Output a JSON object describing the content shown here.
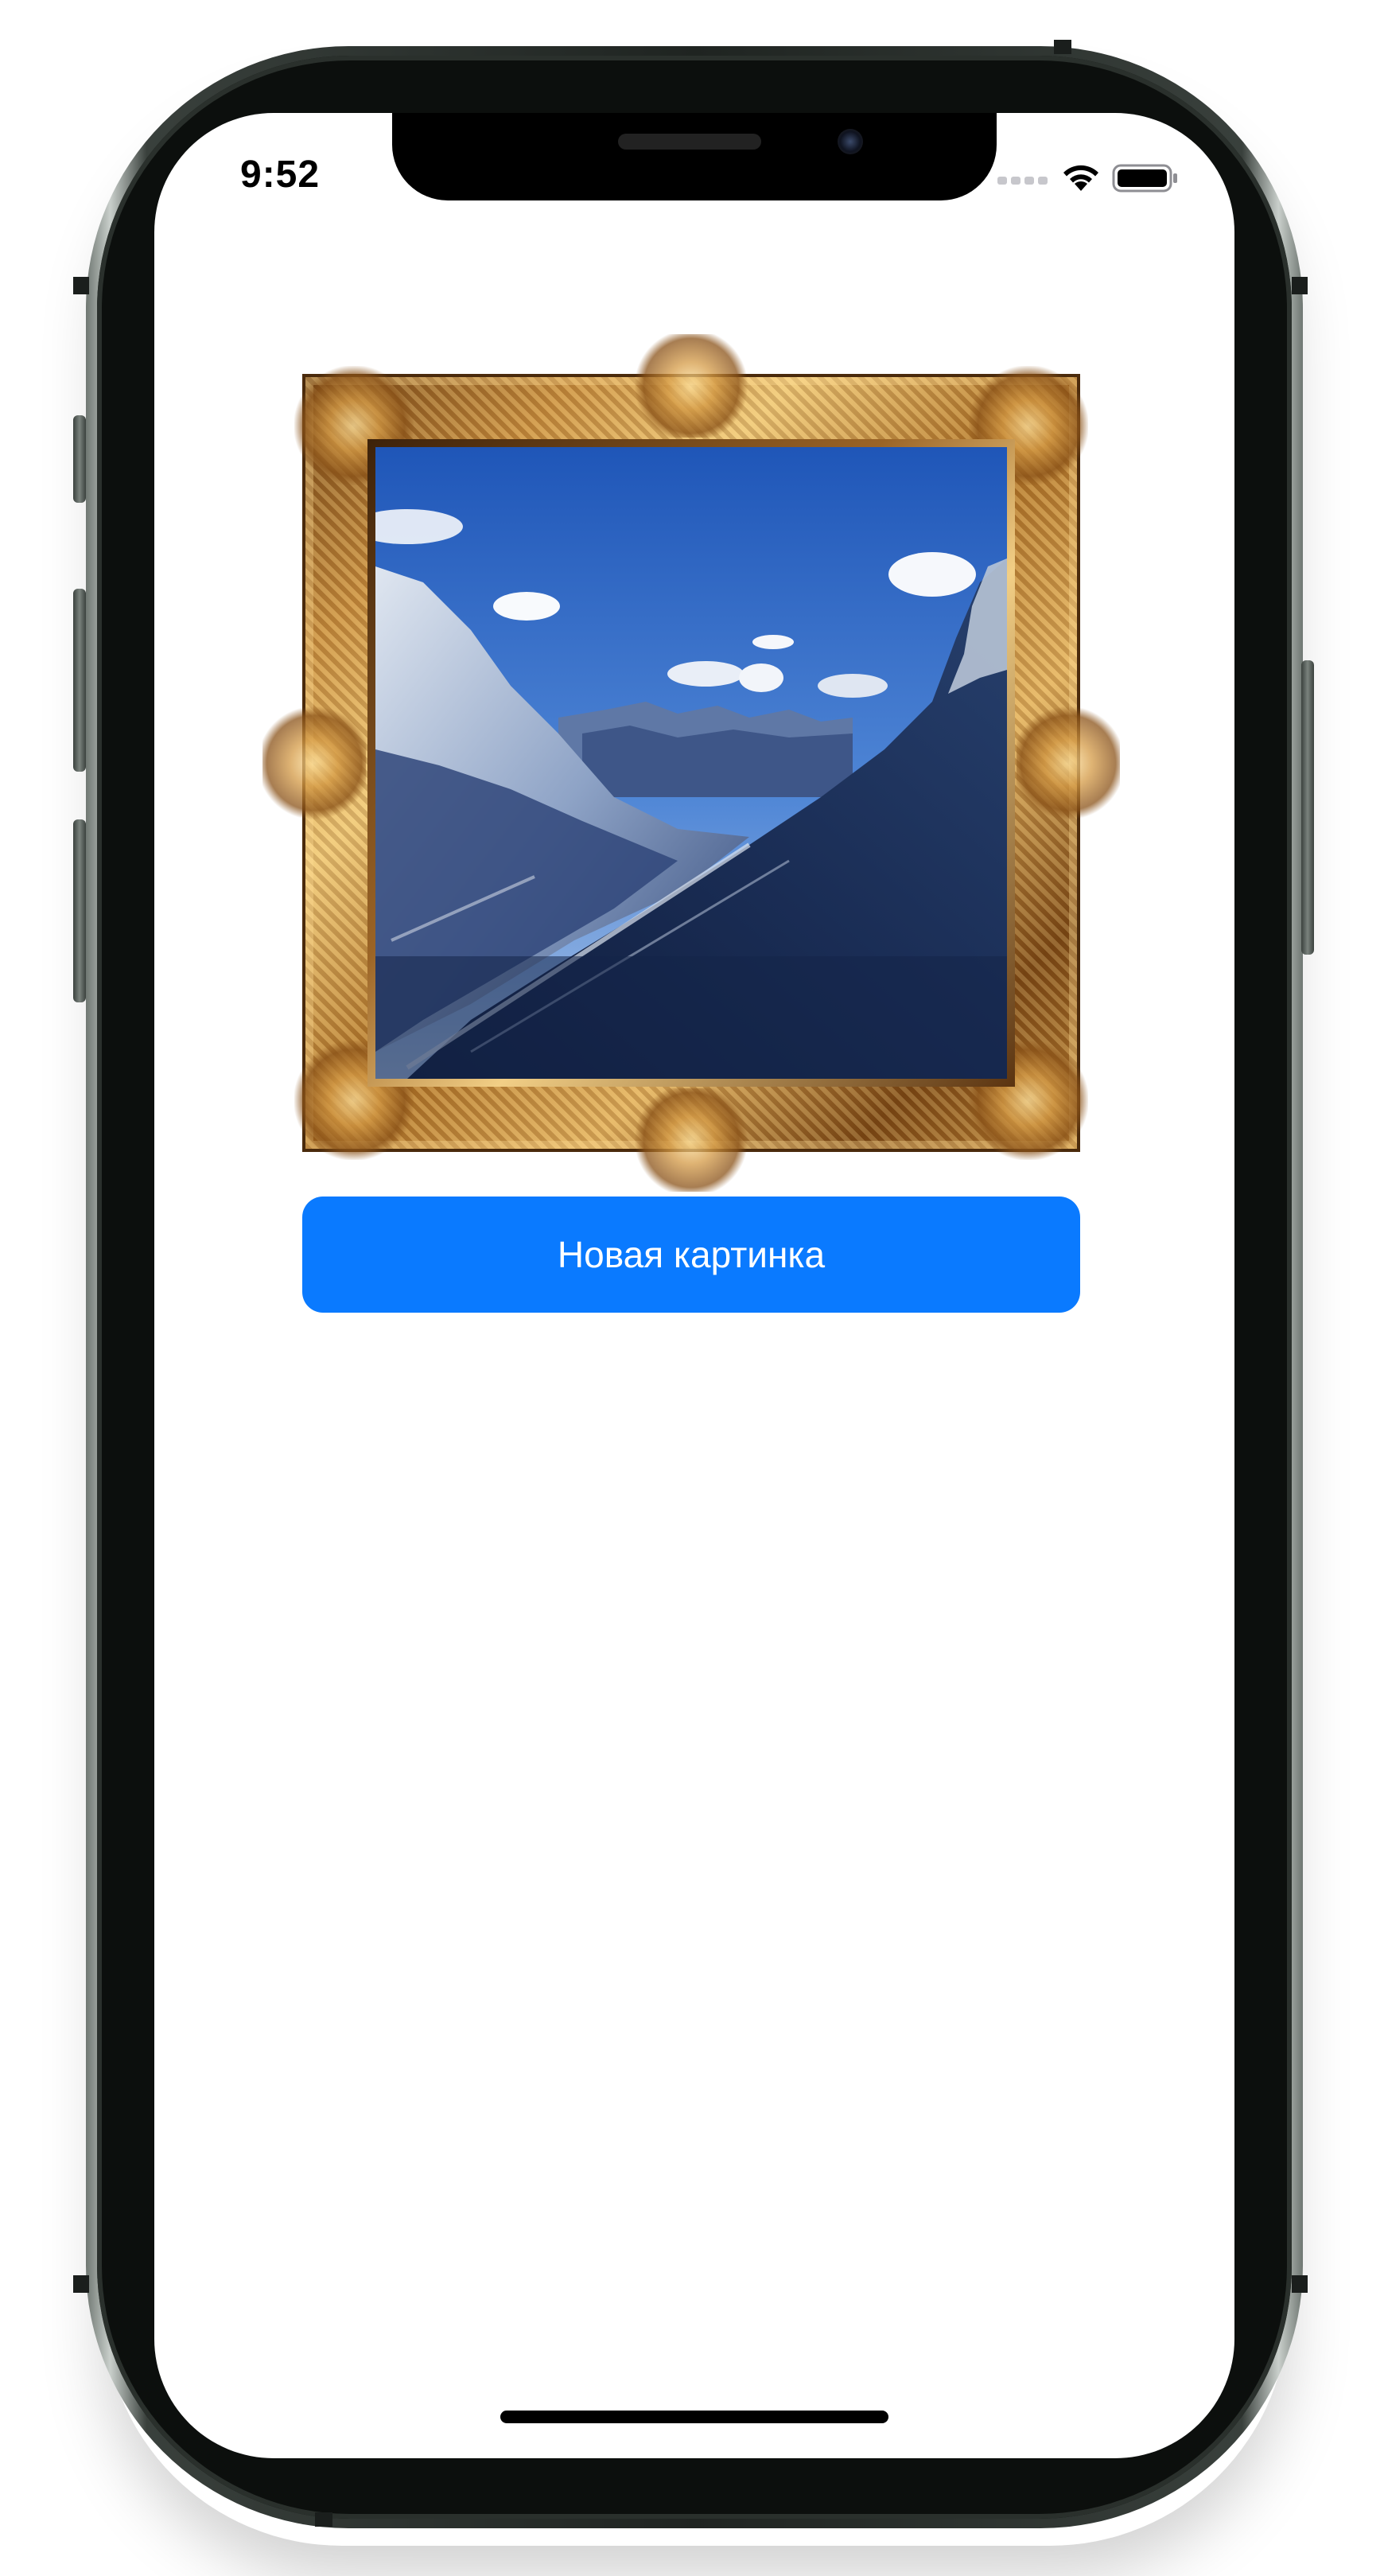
{
  "status_bar": {
    "time": "9:52",
    "icons": [
      "cellular-signal-icon",
      "wifi-icon",
      "battery-icon"
    ]
  },
  "main": {
    "picture": {
      "frame": "ornate-gold-frame",
      "image_subject": "snowy mountain valley under blue sky"
    },
    "new_picture_button_label": "Новая картинка"
  },
  "colors": {
    "button_background": "#0a7aff",
    "button_text": "#ffffff",
    "screen_background": "#ffffff",
    "device_body": "#1f2421"
  }
}
